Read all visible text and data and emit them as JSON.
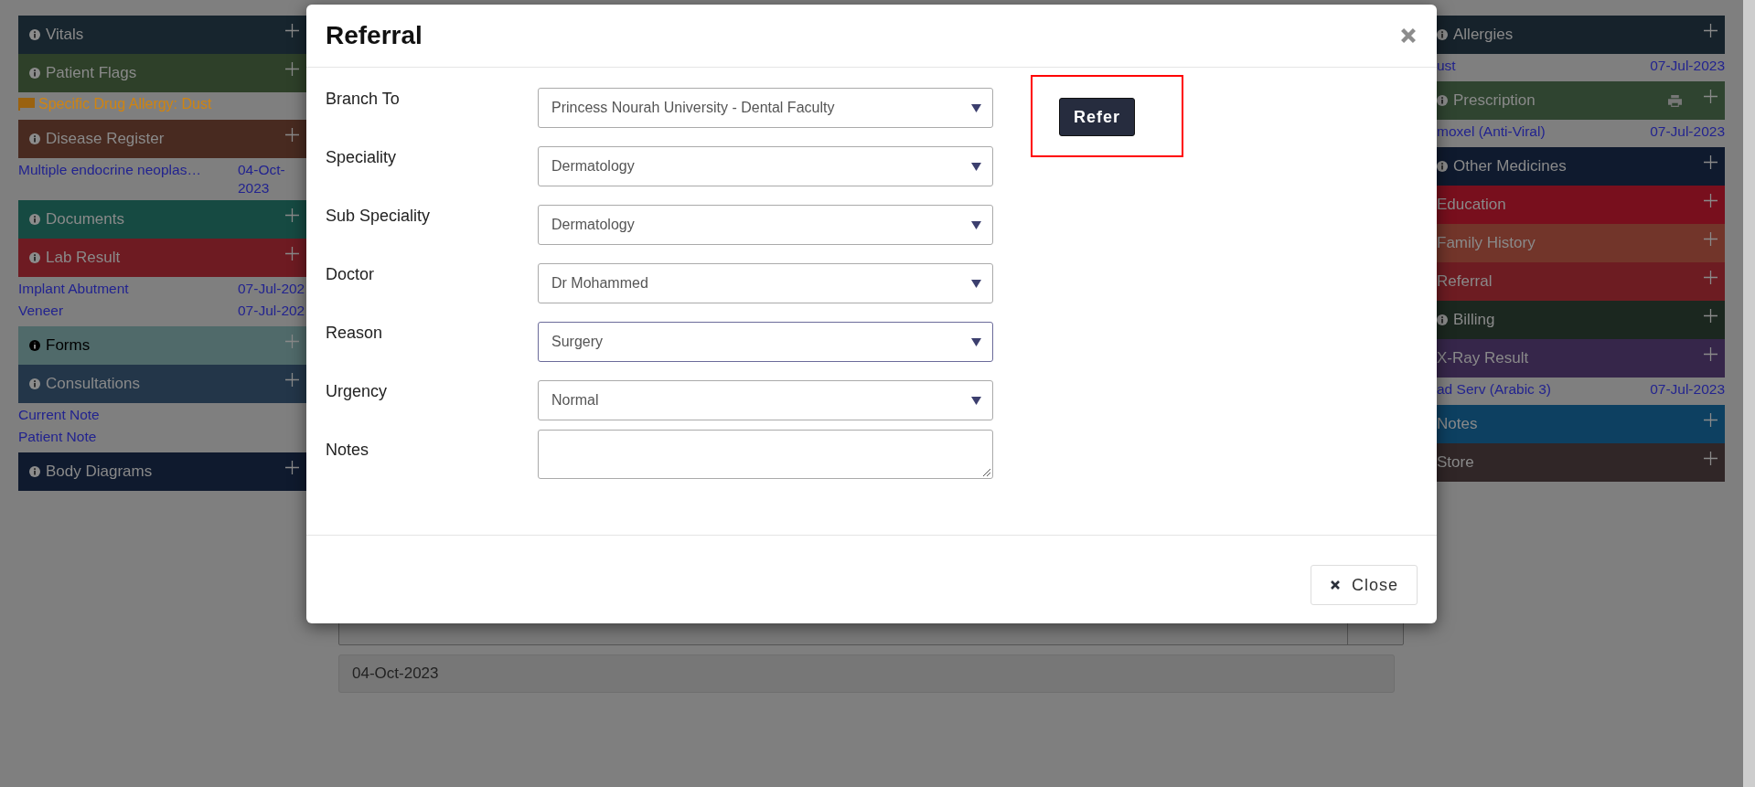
{
  "left_panels": [
    {
      "title": "Vitals",
      "color": "#17252e",
      "info": true
    },
    {
      "title": "Patient Flags",
      "color": "#2e4029",
      "info": true,
      "items": [
        {
          "kind": "flag",
          "text": "Specific Drug Allergy: Dust"
        }
      ]
    },
    {
      "title": "Disease Register",
      "color": "#482a20",
      "info": true,
      "items": [
        {
          "kind": "entry",
          "text": "Multiple endocrine neoplas…",
          "date": "04-Oct-2023"
        }
      ]
    },
    {
      "title": "Documents",
      "color": "#164a42",
      "info": true
    },
    {
      "title": "Lab Result",
      "color": "#6e1b22",
      "info": true,
      "items": [
        {
          "kind": "entry",
          "text": "Implant Abutment",
          "date": "07-Jul-202"
        },
        {
          "kind": "entry",
          "text": "Veneer",
          "date": "07-Jul-202"
        }
      ]
    },
    {
      "title": "Forms",
      "color": "#506a6a",
      "info": true,
      "dark_label": true
    },
    {
      "title": "Consultations",
      "color": "#233649",
      "info": true,
      "items": [
        {
          "kind": "link",
          "text": "Current Note"
        },
        {
          "kind": "link",
          "text": "Patient Note"
        }
      ]
    },
    {
      "title": "Body Diagrams",
      "color": "#0f1a2e",
      "info": true
    }
  ],
  "right_panels": [
    {
      "title": "Allergies",
      "color": "#16222b",
      "info": true,
      "items": [
        {
          "kind": "entry",
          "text": "ust",
          "date": "07-Jul-2023"
        }
      ]
    },
    {
      "title": "Prescription",
      "color": "#2f4430",
      "info": true,
      "printable": true,
      "items": [
        {
          "kind": "entry",
          "text": "moxel (Anti-Viral)",
          "date": "07-Jul-2023"
        }
      ]
    },
    {
      "title": "Other Medicines",
      "color": "#0f1a2e",
      "info": true
    },
    {
      "title": "Education",
      "color": "#780f1d",
      "info": false
    },
    {
      "title": "Family History",
      "color": "#72352a",
      "info": false
    },
    {
      "title": "Referral",
      "color": "#6d1c22",
      "info": false
    },
    {
      "title": "Billing",
      "color": "#1b271f",
      "info": true
    },
    {
      "title": "X-Ray Result",
      "color": "#36264a",
      "info": false,
      "items": [
        {
          "kind": "entry",
          "text": "ad Serv (Arabic 3)",
          "date": "07-Jul-2023"
        }
      ]
    },
    {
      "title": "Notes",
      "color": "#0d4061",
      "info": false
    },
    {
      "title": "Store",
      "color": "#302627",
      "info": false
    }
  ],
  "background": {
    "date": "04-Oct-2023"
  },
  "modal": {
    "title": "Referral",
    "fields": [
      {
        "kind": "select",
        "label": "Branch To",
        "value": "Princess Nourah University - Dental Faculty",
        "focused": false
      },
      {
        "kind": "select",
        "label": "Speciality",
        "value": "Dermatology",
        "focused": false
      },
      {
        "kind": "select",
        "label": "Sub Speciality",
        "value": "Dermatology",
        "focused": false
      },
      {
        "kind": "select",
        "label": "Doctor",
        "value": "Dr Mohammed",
        "focused": false
      },
      {
        "kind": "select",
        "label": "Reason",
        "value": "Surgery",
        "focused": true
      },
      {
        "kind": "select",
        "label": "Urgency",
        "value": "Normal",
        "focused": false
      },
      {
        "kind": "textarea",
        "label": "Notes"
      }
    ],
    "refer_button": "Refer",
    "highlighted": true,
    "close_button": "Close"
  }
}
